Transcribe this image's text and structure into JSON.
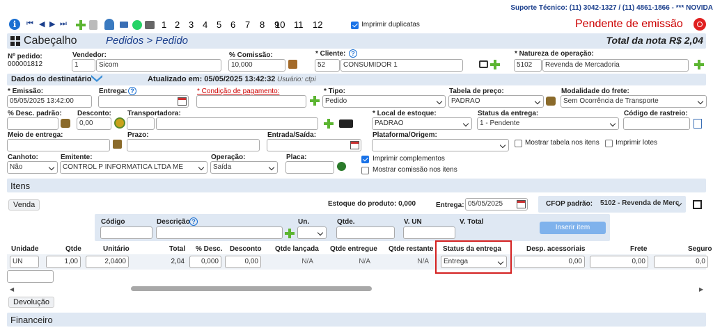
{
  "support": "Suporte Técnico: (11) 3042-1327 / (11) 4861-1866 - *** NOVIDA",
  "toolbar": {
    "pages": [
      "1",
      "2",
      "3",
      "4",
      "5",
      "6",
      "7",
      "8",
      "9",
      "10",
      "11",
      "12"
    ],
    "print_dup": "Imprimir duplicatas"
  },
  "status": "Pendente de emissão",
  "title": "Cabeçalho",
  "breadcrumb": "Pedidos > Pedido",
  "total": "Total da nota R$ 2,04",
  "order": {
    "num_label": "Nº pedido:",
    "num": "000001812",
    "seller_label": "Vendedor:",
    "seller_code": "1",
    "seller_name": "Sicom",
    "comm_label": "% Comissão:",
    "comm": "10,000",
    "client_label": "* Cliente:",
    "client_code": "52",
    "client_name": "CONSUMIDOR 1",
    "nature_label": "* Natureza de operação:",
    "nature_code": "5102",
    "nature_name": "Revenda de Mercadoria"
  },
  "dest": {
    "label": "Dados do destinatário",
    "updated": "Atualizado em: 05/05/2025 13:42:32",
    "user": "Usuário: ctpi"
  },
  "fields": {
    "emissao_l": "* Emissão:",
    "emissao": "05/05/2025 13:42:00",
    "entrega_l": "Entrega:",
    "cond_l": "* Condição de pagamento:",
    "tipo_l": "* Tipo:",
    "tipo": "Pedido",
    "tabela_l": "Tabela de preço:",
    "tabela": "PADRAO",
    "frete_l": "Modalidade do frete:",
    "frete": "Sem Ocorrência de Transporte",
    "desc_l": "% Desc. padrão:",
    "descval_l": "Desconto:",
    "descval": "0,00",
    "transp_l": "Transportadora:",
    "estoque_l": "* Local de estoque:",
    "estoque": "PADRAO",
    "statusent_l": "Status da entrega:",
    "statusent": "1 - Pendente",
    "rastreio_l": "Código de rastreio:",
    "meio_l": "Meio de entrega:",
    "prazo_l": "Prazo:",
    "entsai_l": "Entrada/Saída:",
    "plat_l": "Plataforma/Origem:",
    "mostrar_tabela": "Mostrar tabela nos itens",
    "imprimir_lotes": "Imprimir lotes",
    "canhoto_l": "Canhoto:",
    "canhoto": "Não",
    "emitente_l": "Emitente:",
    "emitente": "CONTROL P INFORMATICA LTDA ME",
    "operacao_l": "Operação:",
    "operacao": "Saída",
    "placa_l": "Placa:",
    "imp_compl": "Imprimir complementos",
    "mostrar_comissao": "Mostrar comissão nos itens"
  },
  "itens": {
    "title": "Itens",
    "venda": "Venda",
    "estoque": "Estoque do produto: 0,000",
    "entrega_l": "Entrega:",
    "entrega": "05/05/2025",
    "cfop_l": "CFOP padrão:",
    "cfop": "5102 - Revenda de Merc",
    "codigo_l": "Código",
    "desc_l": "Descrição",
    "un_l": "Un.",
    "qtde_l": "Qtde.",
    "vun_l": "V. UN",
    "vtotal_l": "V. Total",
    "inserir": "Inserir item",
    "cols": [
      "Unidade",
      "Qtde",
      "Unitário",
      "Total",
      "% Desc.",
      "Desconto",
      "Qtde lançada",
      "Qtde entregue",
      "Qtde restante",
      "Status da entrega",
      "Desp. acessoriais",
      "Frete",
      "Seguro"
    ],
    "row": {
      "un": "UN",
      "qtde": "1,00",
      "unit": "2,0400",
      "total": "2,04",
      "pdesc": "0,000",
      "desc": "0,00",
      "lanc": "N/A",
      "entr": "N/A",
      "rest": "N/A",
      "status": "Entrega",
      "desp": "0,00",
      "frete": "0,00",
      "seg": "0,0"
    }
  },
  "devolucao": "Devolução",
  "financeiro": "Financeiro",
  "colors": {
    "accent": "#1a3e8c",
    "status_red": "#cc0000",
    "band": "#dfe8f3",
    "plus": "#5cb531"
  }
}
